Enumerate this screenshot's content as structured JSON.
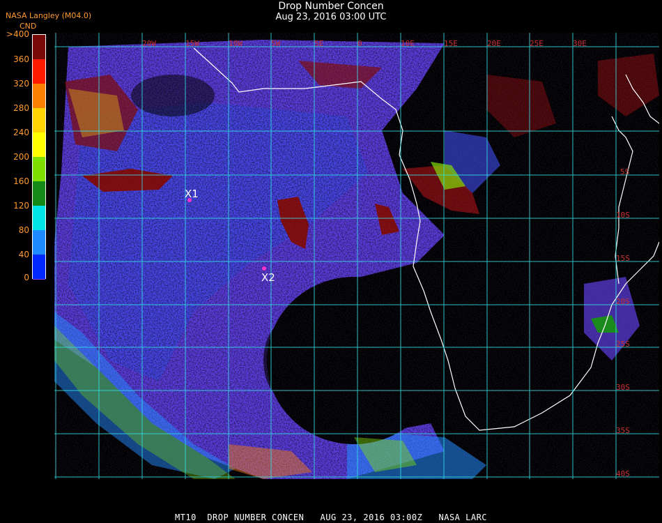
{
  "header": {
    "title": "Drop Number Concen",
    "datetime": "Aug 23, 2016 03:00 UTC",
    "source": "NASA Langley (M04.0)",
    "unit": "CND"
  },
  "colorbar": {
    "labels": [
      ">400",
      "360",
      "320",
      "280",
      "240",
      "200",
      "160",
      "120",
      "80",
      "40",
      "0"
    ],
    "colors": [
      "#7a0a0a",
      "#ff1a00",
      "#ff8000",
      "#ffd400",
      "#ffff00",
      "#7fe000",
      "#168a16",
      "#00e5e5",
      "#1e8cff",
      "#0028ff",
      "#8a3cff"
    ]
  },
  "map": {
    "lat_labels": [
      "5S",
      "10S",
      "15S",
      "20S",
      "25S",
      "30S",
      "35S",
      "40S"
    ],
    "lon_labels": [
      "20W",
      "15W",
      "10W",
      "5W",
      "0",
      "5E",
      "10E",
      "15E",
      "20E",
      "25E",
      "30E"
    ],
    "markers": [
      {
        "label": "X1",
        "color": "#ff33cc"
      },
      {
        "label": "X2",
        "color": "#ff33cc"
      }
    ],
    "colors": {
      "grid": "#33e0e6",
      "coast": "#ffffff",
      "label": "#c83232"
    }
  },
  "footer": "MT10  DROP NUMBER CONCEN   AUG 23, 2016 03:00Z   NASA LARC"
}
